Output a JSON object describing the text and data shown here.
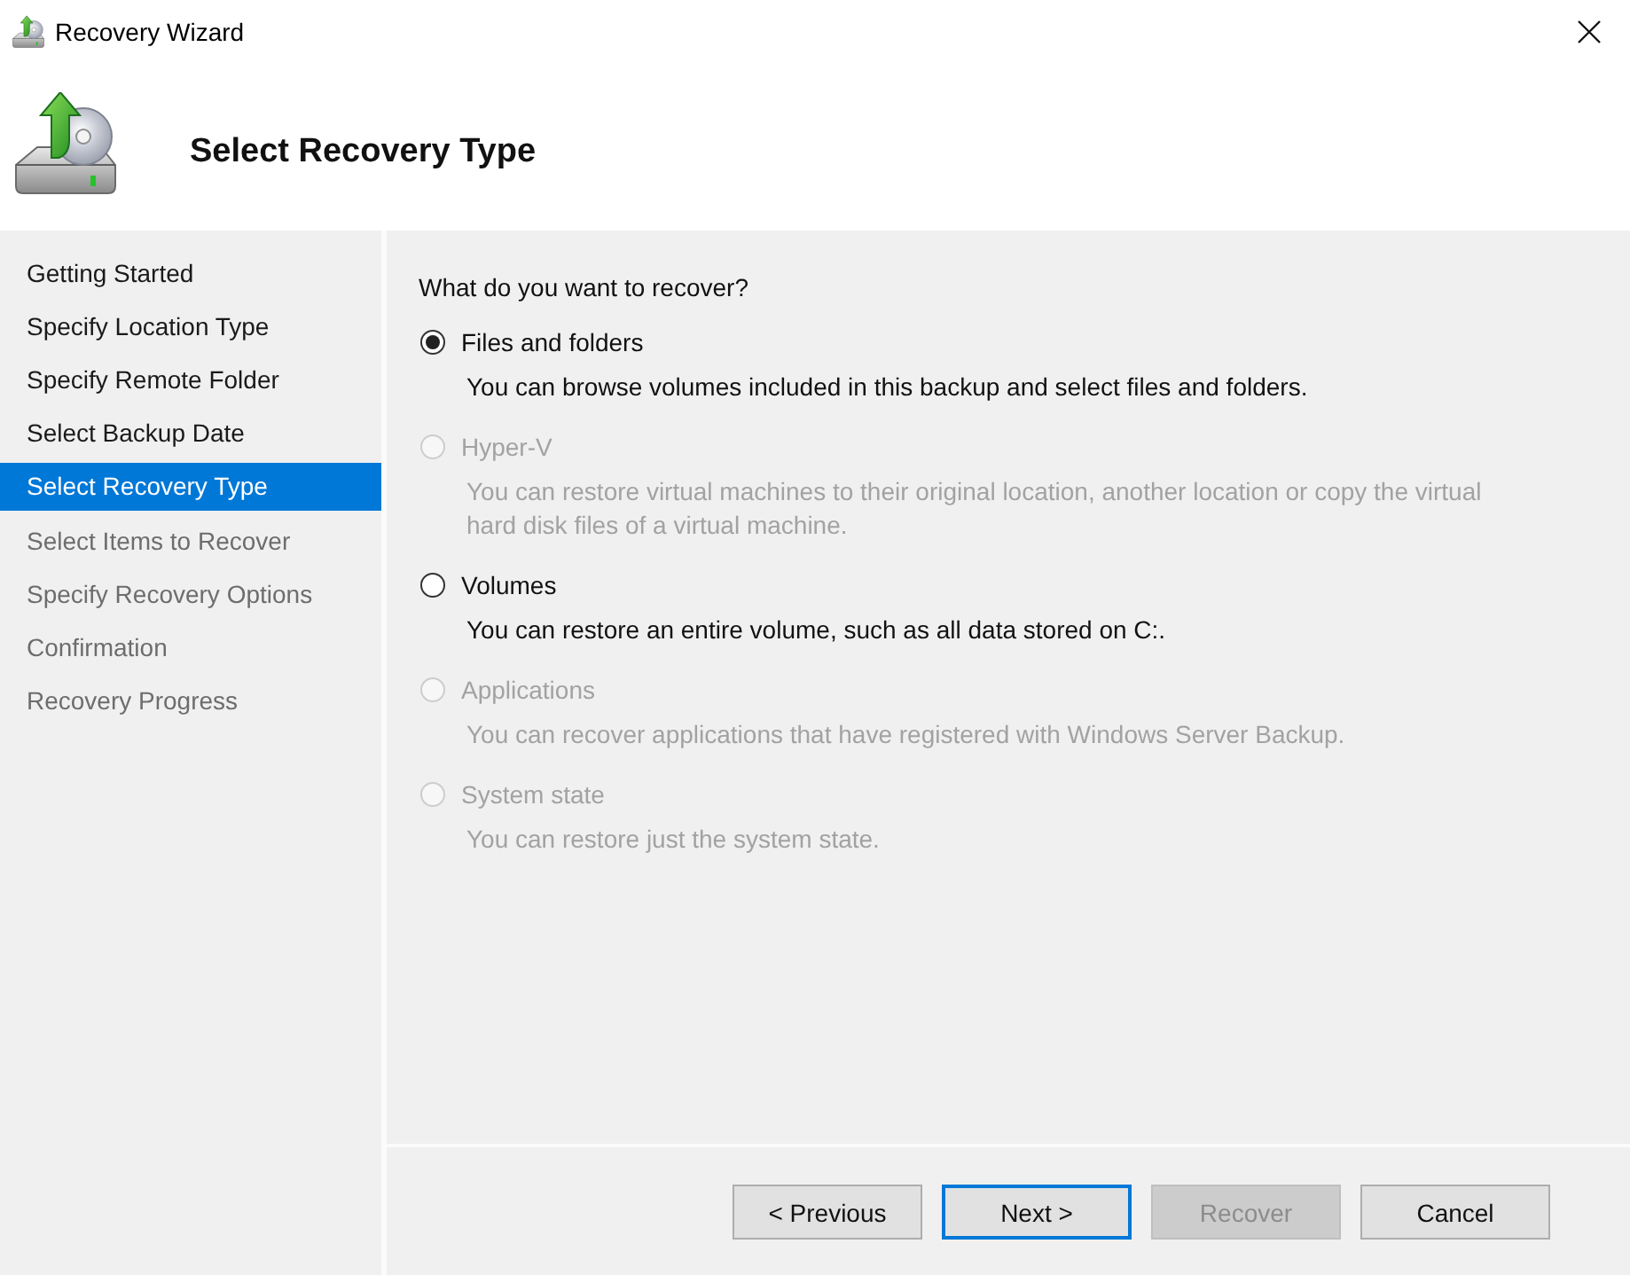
{
  "window": {
    "title": "Recovery Wizard"
  },
  "header": {
    "title": "Select Recovery Type"
  },
  "steps": [
    {
      "label": "Getting Started",
      "selected": false,
      "completed": true
    },
    {
      "label": "Specify Location Type",
      "selected": false,
      "completed": true
    },
    {
      "label": "Specify Remote Folder",
      "selected": false,
      "completed": true
    },
    {
      "label": "Select Backup Date",
      "selected": false,
      "completed": true
    },
    {
      "label": "Select Recovery Type",
      "selected": true,
      "completed": false
    },
    {
      "label": "Select Items to Recover",
      "selected": false,
      "completed": false
    },
    {
      "label": "Specify Recovery Options",
      "selected": false,
      "completed": false
    },
    {
      "label": "Confirmation",
      "selected": false,
      "completed": false
    },
    {
      "label": "Recovery Progress",
      "selected": false,
      "completed": false
    }
  ],
  "question": "What do you want to recover?",
  "options": [
    {
      "label": "Files and folders",
      "description": "You can browse volumes included in this backup and select files and folders.",
      "selected": true,
      "disabled": false
    },
    {
      "label": "Hyper-V",
      "description": "You can restore virtual machines to their original location, another location or copy the virtual hard disk files of a virtual machine.",
      "selected": false,
      "disabled": true
    },
    {
      "label": "Volumes",
      "description": "You can restore an entire volume, such as all data stored on C:.",
      "selected": false,
      "disabled": false
    },
    {
      "label": "Applications",
      "description": "You can recover applications that have registered with Windows Server Backup.",
      "selected": false,
      "disabled": true
    },
    {
      "label": "System state",
      "description": "You can restore just the system state.",
      "selected": false,
      "disabled": true
    }
  ],
  "buttons": [
    {
      "label": "< Previous",
      "focused": false,
      "disabled": false
    },
    {
      "label": "Next >",
      "focused": true,
      "disabled": false
    },
    {
      "label": "Recover",
      "focused": false,
      "disabled": true
    },
    {
      "label": "Cancel",
      "focused": false,
      "disabled": false
    }
  ]
}
